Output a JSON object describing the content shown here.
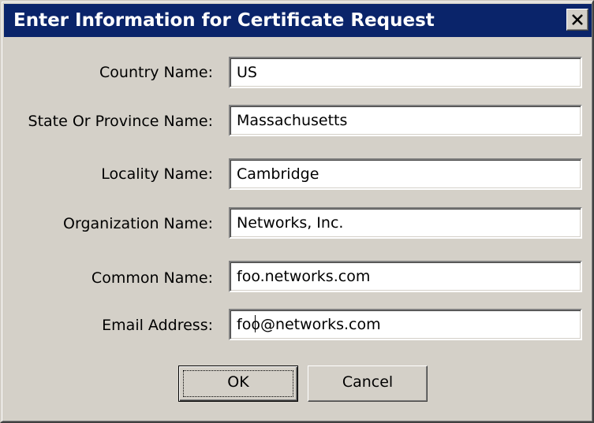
{
  "window": {
    "title": "Enter Information for Certificate Request",
    "close_icon": "close-icon"
  },
  "form": {
    "fields": [
      {
        "label": "Country Name:",
        "value": "US"
      },
      {
        "label": "State Or Province Name:",
        "value": "Massachusetts"
      },
      {
        "label": "Locality Name:",
        "value": "Cambridge"
      },
      {
        "label": "Organization Name:",
        "value": "Networks, Inc."
      },
      {
        "label": "Common Name:",
        "value": "foo.networks.com"
      },
      {
        "label": "Email Address:",
        "value": "foo@networks.com"
      }
    ]
  },
  "buttons": {
    "ok_label": "OK",
    "cancel_label": "Cancel"
  },
  "colors": {
    "titlebar": "#0a246a",
    "dialog_face": "#d4d0c8"
  }
}
